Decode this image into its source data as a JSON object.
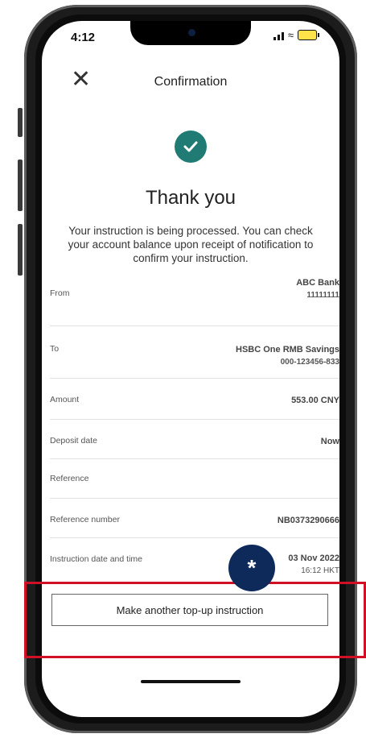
{
  "status": {
    "time": "4:12"
  },
  "header": {
    "title": "Confirmation",
    "close_icon": "close-icon"
  },
  "success": {
    "icon": "check-icon",
    "color": "#1f7b73",
    "heading": "Thank you",
    "message": "Your instruction is being processed. You can check your account balance upon receipt of notification to confirm your instruction."
  },
  "details": {
    "from": {
      "label": "From",
      "value": "ABC Bank",
      "sub": "11111111"
    },
    "to": {
      "label": "To",
      "value": "HSBC  One RMB Savings",
      "sub": "000-123456-833"
    },
    "amount": {
      "label": "Amount",
      "value": "553.00 CNY"
    },
    "deposit_date": {
      "label": "Deposit date",
      "value": "Now"
    },
    "reference": {
      "label": "Reference",
      "value": ""
    },
    "reference_number": {
      "label": "Reference number",
      "value": "NB0373290666"
    },
    "instruction_datetime": {
      "label": "Instruction date and time",
      "value": "03 Nov 2022",
      "sub": "16:12 HKT"
    }
  },
  "cta": {
    "label": "Make another top-up instruction"
  },
  "overlay": {
    "marker": "*",
    "highlight_color": "#d10f25",
    "marker_color": "#0e2a5a"
  }
}
